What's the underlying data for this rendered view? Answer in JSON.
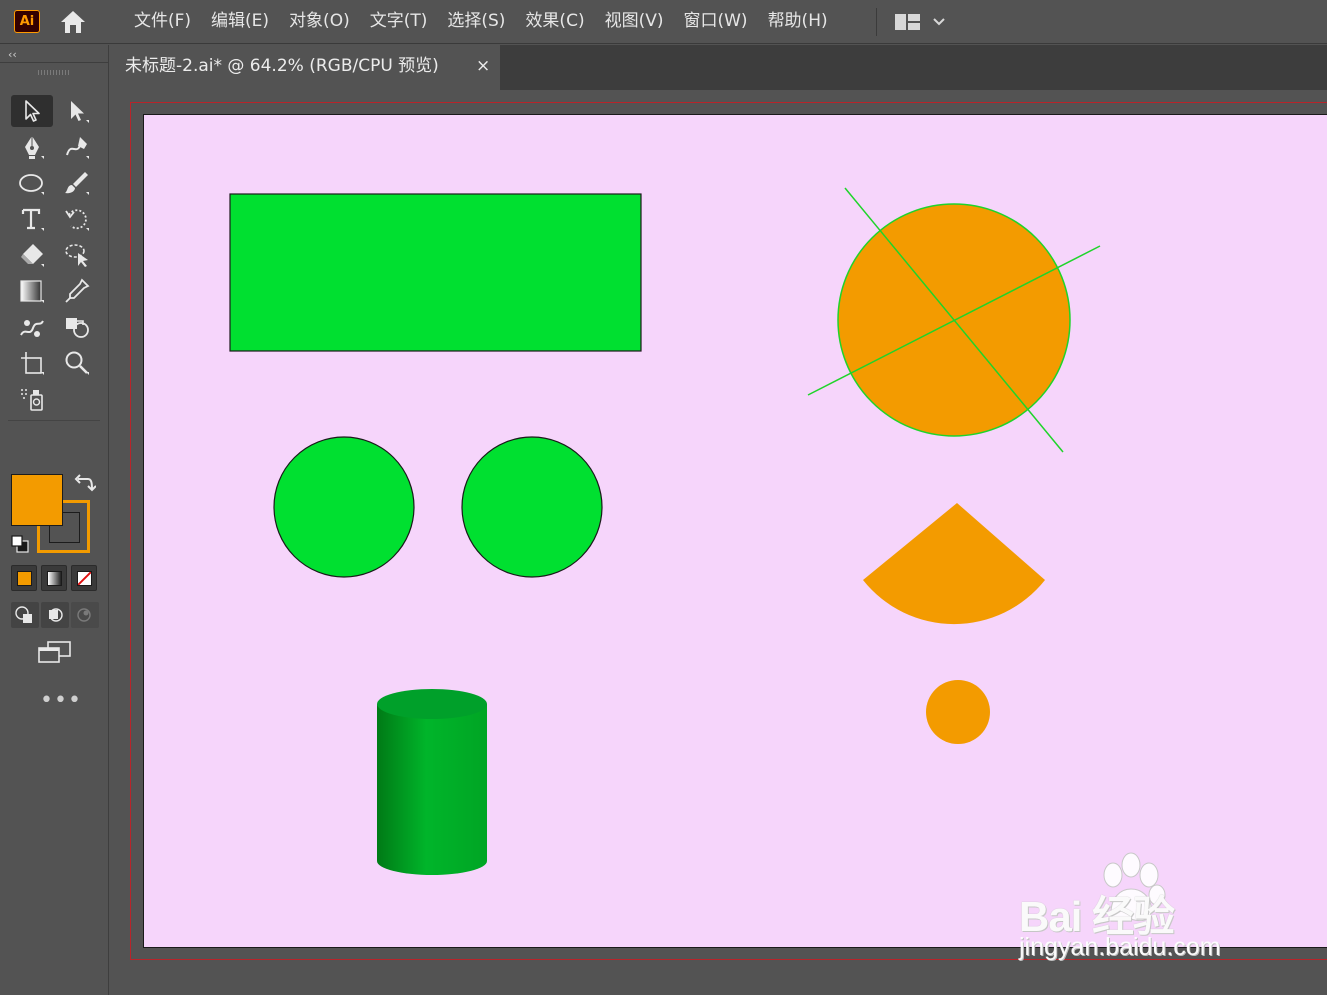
{
  "app": {
    "logo_text": "Ai",
    "menu": [
      "文件(F)",
      "编辑(E)",
      "对象(O)",
      "文字(T)",
      "选择(S)",
      "效果(C)",
      "视图(V)",
      "窗口(W)",
      "帮助(H)"
    ]
  },
  "document_tab": {
    "title": "未标题-2.ai* @ 64.2% (RGB/CPU 预览)",
    "close_glyph": "×"
  },
  "toolbar": {
    "collapse_glyph": "‹‹",
    "more_glyph": "•••",
    "tools": [
      "selection-tool",
      "direct-selection-tool",
      "pen-tool",
      "curvature-tool",
      "ellipse-tool",
      "paintbrush-tool",
      "type-tool",
      "rotate-tool",
      "eraser-tool",
      "lasso-tool",
      "gradient-tool",
      "eyedropper-tool",
      "puppet-warp-tool",
      "shape-builder-tool",
      "artboard-tool",
      "zoom-tool",
      "symbol-sprayer-tool"
    ],
    "fill_color": "#f39b00",
    "stroke_color": "#f39b00"
  },
  "artwork": {
    "artboard_color": "#f6d5fb",
    "green": "#00e030",
    "orange": "#f39b00",
    "cylinder_green": "#009e20"
  },
  "watermark": {
    "brand": "Bai  经验",
    "url": "jingyan.baidu.com"
  }
}
